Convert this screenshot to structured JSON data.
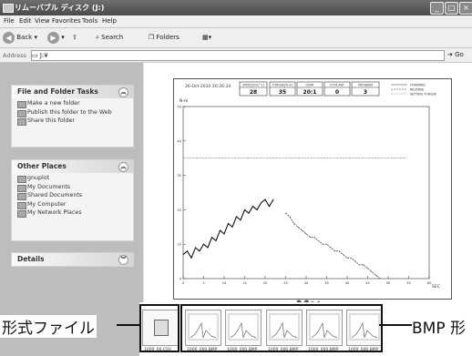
{
  "window": {
    "title": "リムーバブル ディスク (J:)"
  },
  "menu": [
    "File",
    "Edit",
    "View",
    "Favorites",
    "Tools",
    "Help"
  ],
  "toolbar": {
    "back": "Back",
    "search": "Search",
    "folders": "Folders"
  },
  "address": {
    "label": "Address",
    "value": "J:¥",
    "go": "Go"
  },
  "tasks": {
    "title": "File and Folder Tasks",
    "items": [
      "Make a new folder",
      "Publish this folder to the Web",
      "Share this folder"
    ]
  },
  "other_places": {
    "title": "Other Places",
    "items": [
      "gnuplot",
      "My Documents",
      "Shared Documents",
      "My Computer",
      "My Network Places"
    ]
  },
  "details": {
    "title": "Details"
  },
  "preview": {
    "date": "26-Oct-2010",
    "time": "20:26:34",
    "fields": [
      {
        "label": "SPEED[min^1]",
        "value": "28"
      },
      {
        "label": "TORQUE[N-m]",
        "value": "35"
      },
      {
        "label": "GEAR",
        "value": "20:1"
      },
      {
        "label": "COOLANT",
        "value": "0"
      },
      {
        "label": "PROGRAM",
        "value": "3"
      }
    ],
    "legend": [
      "FORWARD",
      "REVERSE",
      "SETTING TORQUE"
    ]
  },
  "thumbnails": [
    {
      "label": "1000_00.CSV",
      "kind": "csv"
    },
    {
      "label": "1000_000.BMP",
      "kind": "bmp"
    },
    {
      "label": "1000_000.BMP",
      "kind": "bmp"
    },
    {
      "label": "1000_000.BMP",
      "kind": "bmp"
    },
    {
      "label": "1000_000.BMP",
      "kind": "bmp"
    },
    {
      "label": "1000_000.BMP",
      "kind": "bmp"
    }
  ],
  "annotations": {
    "left": "形式ファイル",
    "right": "BMP 形"
  },
  "chart_data": {
    "type": "line",
    "ylabel": "N-m",
    "xlabel": "SEC",
    "x_ticks": [
      0,
      5,
      10,
      15,
      20,
      25,
      30,
      35,
      40,
      45,
      50,
      55,
      60
    ],
    "y_ticks": [
      0,
      10,
      20,
      30,
      40,
      50
    ],
    "xlim": [
      0,
      60
    ],
    "ylim": [
      0,
      50
    ],
    "setting_torque": 35,
    "series": [
      {
        "name": "FORWARD",
        "x": [
          0,
          1,
          2,
          3,
          4,
          5,
          6,
          7,
          8,
          9,
          10,
          11,
          12,
          13,
          14,
          15,
          16,
          17,
          18,
          19,
          20,
          21,
          22
        ],
        "y": [
          7,
          8,
          6,
          9,
          8,
          10,
          9,
          12,
          11,
          14,
          13,
          16,
          15,
          18,
          17,
          20,
          19,
          21,
          20,
          22,
          23,
          21,
          23
        ]
      },
      {
        "name": "REVERSE",
        "x": [
          25,
          26,
          27,
          28,
          29,
          30,
          31,
          32,
          33,
          34,
          35,
          36,
          37,
          38,
          39,
          40,
          41,
          42,
          43,
          44,
          45,
          46,
          47,
          48
        ],
        "y": [
          19,
          18,
          16,
          15,
          14,
          13,
          12,
          12,
          11,
          10,
          10,
          9,
          8,
          8,
          7,
          6,
          6,
          5,
          4,
          4,
          3,
          2,
          1,
          0
        ]
      }
    ]
  }
}
